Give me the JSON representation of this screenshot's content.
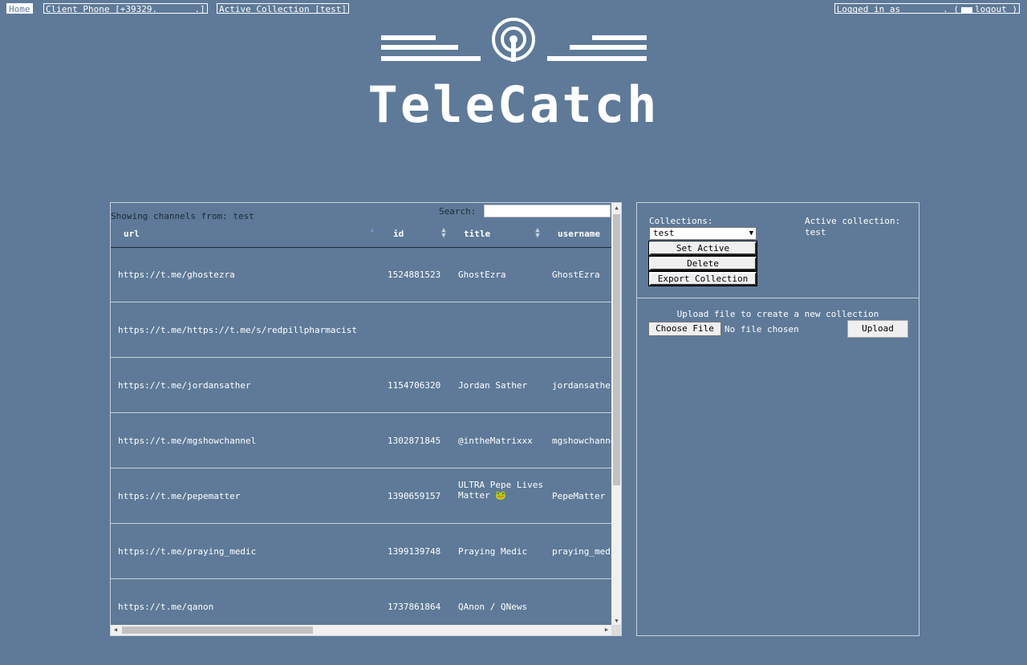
{
  "topbar": {
    "home": "Home",
    "client_phone": "Client Phone [+39329.       .]",
    "active_collection": "Active Collection [test]",
    "logged_in_prefix": "Logged in as        . (",
    "logout": "logout )"
  },
  "brand": {
    "name": "TeleCatch"
  },
  "table": {
    "showing": "Showing channels from: test",
    "search_label": "Search:",
    "search_value": "",
    "columns": [
      "url",
      "id",
      "title",
      "username"
    ],
    "rows": [
      {
        "url": "https://t.me/ghostezra",
        "id": "1524881523",
        "title": "GhostEzra",
        "username": "GhostEzra"
      },
      {
        "url": "https://t.me/https://t.me/s/redpillpharmacist",
        "id": "",
        "title": "",
        "username": ""
      },
      {
        "url": "https://t.me/jordansather",
        "id": "1154706320",
        "title": "Jordan Sather",
        "username": "jordansather"
      },
      {
        "url": "https://t.me/mgshowchannel",
        "id": "1302871845",
        "title": "@intheMatrixxx",
        "username": "mgshowchannel"
      },
      {
        "url": "https://t.me/pepematter",
        "id": "1390659157",
        "title": "ULTRA Pepe Lives Matter 🐸",
        "username": "PepeMatter"
      },
      {
        "url": "https://t.me/praying_medic",
        "id": "1399139748",
        "title": "Praying Medic",
        "username": "praying_medic"
      },
      {
        "url": "https://t.me/qanon",
        "id": "1737861864",
        "title": "QAnon / QNews",
        "username": ""
      }
    ]
  },
  "collections": {
    "label": "Collections:",
    "selected": "test",
    "set_active": "Set Active",
    "delete": "Delete",
    "export": "Export Collection",
    "active_label": "Active collection:",
    "active_value": "test"
  },
  "upload": {
    "label": "Upload file to create a new collection",
    "choose": "Choose File",
    "no_file": "No file chosen",
    "button": "Upload"
  }
}
